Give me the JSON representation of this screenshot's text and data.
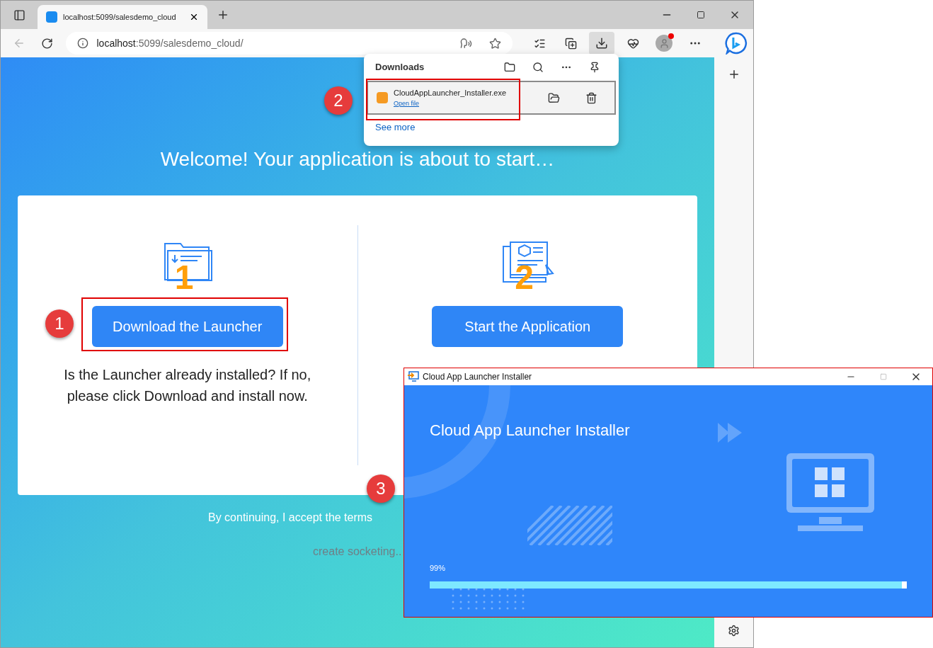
{
  "browser": {
    "tab": {
      "title": "localhost:5099/salesdemo_cloud",
      "selected": true
    },
    "address": {
      "host": "localhost",
      "path": ":5099/salesdemo_cloud/"
    }
  },
  "downloads": {
    "title": "Downloads",
    "items": [
      {
        "file": "CloudAppLauncher_Installer.exe",
        "action": "Open file",
        "selected": true
      }
    ],
    "see_more": "See more"
  },
  "page": {
    "heading": "Welcome! Your application is about to start…",
    "steps": [
      {
        "number": "1",
        "button": "Download the Launcher",
        "description": "Is the Launcher already installed? If no, please click Download and install now."
      },
      {
        "number": "2",
        "button": "Start the Application"
      }
    ],
    "terms": "By continuing, I accept the terms",
    "status": "create socketing.."
  },
  "installer": {
    "title": "Cloud App Launcher Installer",
    "heading": "Cloud App Launcher Installer",
    "progress": {
      "reading": "99%",
      "level": 0.99
    }
  },
  "callouts": [
    "1",
    "2",
    "3"
  ]
}
